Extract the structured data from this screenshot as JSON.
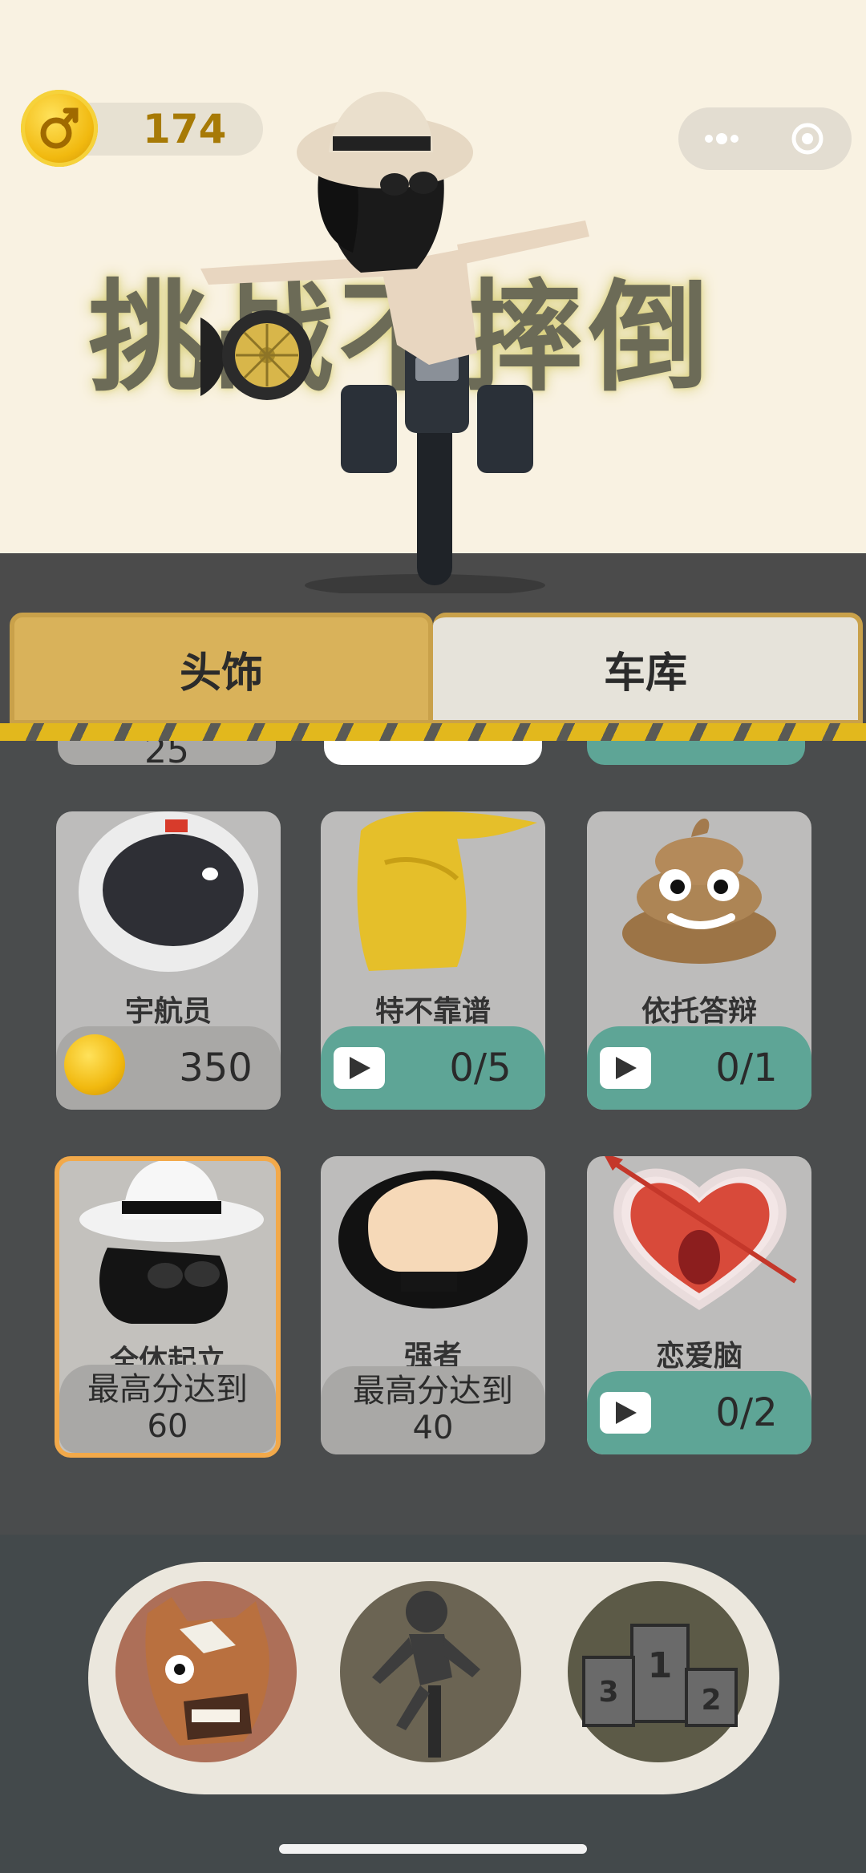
{
  "header": {
    "coin_count": "174",
    "game_title": "挑战不摔倒"
  },
  "tabs": [
    {
      "label": "头饰"
    },
    {
      "label": "车库"
    }
  ],
  "partial_row": {
    "first_card_value": "25"
  },
  "cards": [
    {
      "name": "宇航员",
      "price_type": "coin",
      "price": "350"
    },
    {
      "name": "特不靠谱",
      "price_type": "video",
      "price": "0/5"
    },
    {
      "name": "依托答辩",
      "price_type": "video",
      "price": "0/1"
    },
    {
      "name": "全体起立",
      "price_type": "score",
      "condition_line1": "最高分达到",
      "condition_line2": "60",
      "selected": true
    },
    {
      "name": "强者",
      "price_type": "score",
      "condition_line1": "最高分达到",
      "condition_line2": "40"
    },
    {
      "name": "恋爱脑",
      "price_type": "video",
      "price": "0/2"
    }
  ],
  "dock": [
    "horse-mask-icon",
    "rider-icon",
    "podium-icon"
  ],
  "colors": {
    "accent_gold": "#d9b25a",
    "video_green": "#5ea596",
    "selected_border": "#f2a94a"
  }
}
